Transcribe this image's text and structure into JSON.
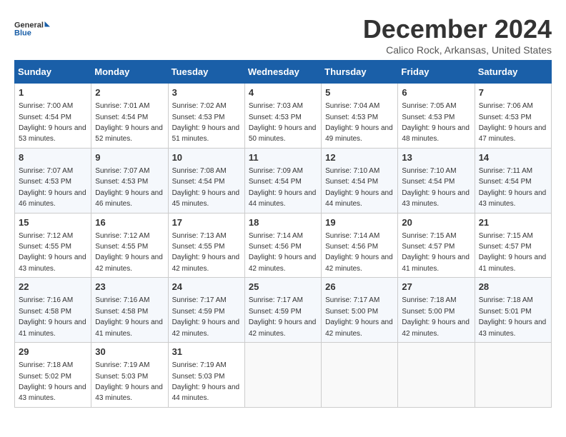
{
  "logo": {
    "line1": "General",
    "line2": "Blue"
  },
  "title": "December 2024",
  "location": "Calico Rock, Arkansas, United States",
  "days_of_week": [
    "Sunday",
    "Monday",
    "Tuesday",
    "Wednesday",
    "Thursday",
    "Friday",
    "Saturday"
  ],
  "weeks": [
    [
      {
        "day": "1",
        "sunrise": "7:00 AM",
        "sunset": "4:54 PM",
        "daylight": "9 hours and 53 minutes."
      },
      {
        "day": "2",
        "sunrise": "7:01 AM",
        "sunset": "4:54 PM",
        "daylight": "9 hours and 52 minutes."
      },
      {
        "day": "3",
        "sunrise": "7:02 AM",
        "sunset": "4:53 PM",
        "daylight": "9 hours and 51 minutes."
      },
      {
        "day": "4",
        "sunrise": "7:03 AM",
        "sunset": "4:53 PM",
        "daylight": "9 hours and 50 minutes."
      },
      {
        "day": "5",
        "sunrise": "7:04 AM",
        "sunset": "4:53 PM",
        "daylight": "9 hours and 49 minutes."
      },
      {
        "day": "6",
        "sunrise": "7:05 AM",
        "sunset": "4:53 PM",
        "daylight": "9 hours and 48 minutes."
      },
      {
        "day": "7",
        "sunrise": "7:06 AM",
        "sunset": "4:53 PM",
        "daylight": "9 hours and 47 minutes."
      }
    ],
    [
      {
        "day": "8",
        "sunrise": "7:07 AM",
        "sunset": "4:53 PM",
        "daylight": "9 hours and 46 minutes."
      },
      {
        "day": "9",
        "sunrise": "7:07 AM",
        "sunset": "4:53 PM",
        "daylight": "9 hours and 46 minutes."
      },
      {
        "day": "10",
        "sunrise": "7:08 AM",
        "sunset": "4:54 PM",
        "daylight": "9 hours and 45 minutes."
      },
      {
        "day": "11",
        "sunrise": "7:09 AM",
        "sunset": "4:54 PM",
        "daylight": "9 hours and 44 minutes."
      },
      {
        "day": "12",
        "sunrise": "7:10 AM",
        "sunset": "4:54 PM",
        "daylight": "9 hours and 44 minutes."
      },
      {
        "day": "13",
        "sunrise": "7:10 AM",
        "sunset": "4:54 PM",
        "daylight": "9 hours and 43 minutes."
      },
      {
        "day": "14",
        "sunrise": "7:11 AM",
        "sunset": "4:54 PM",
        "daylight": "9 hours and 43 minutes."
      }
    ],
    [
      {
        "day": "15",
        "sunrise": "7:12 AM",
        "sunset": "4:55 PM",
        "daylight": "9 hours and 43 minutes."
      },
      {
        "day": "16",
        "sunrise": "7:12 AM",
        "sunset": "4:55 PM",
        "daylight": "9 hours and 42 minutes."
      },
      {
        "day": "17",
        "sunrise": "7:13 AM",
        "sunset": "4:55 PM",
        "daylight": "9 hours and 42 minutes."
      },
      {
        "day": "18",
        "sunrise": "7:14 AM",
        "sunset": "4:56 PM",
        "daylight": "9 hours and 42 minutes."
      },
      {
        "day": "19",
        "sunrise": "7:14 AM",
        "sunset": "4:56 PM",
        "daylight": "9 hours and 42 minutes."
      },
      {
        "day": "20",
        "sunrise": "7:15 AM",
        "sunset": "4:57 PM",
        "daylight": "9 hours and 41 minutes."
      },
      {
        "day": "21",
        "sunrise": "7:15 AM",
        "sunset": "4:57 PM",
        "daylight": "9 hours and 41 minutes."
      }
    ],
    [
      {
        "day": "22",
        "sunrise": "7:16 AM",
        "sunset": "4:58 PM",
        "daylight": "9 hours and 41 minutes."
      },
      {
        "day": "23",
        "sunrise": "7:16 AM",
        "sunset": "4:58 PM",
        "daylight": "9 hours and 41 minutes."
      },
      {
        "day": "24",
        "sunrise": "7:17 AM",
        "sunset": "4:59 PM",
        "daylight": "9 hours and 42 minutes."
      },
      {
        "day": "25",
        "sunrise": "7:17 AM",
        "sunset": "4:59 PM",
        "daylight": "9 hours and 42 minutes."
      },
      {
        "day": "26",
        "sunrise": "7:17 AM",
        "sunset": "5:00 PM",
        "daylight": "9 hours and 42 minutes."
      },
      {
        "day": "27",
        "sunrise": "7:18 AM",
        "sunset": "5:00 PM",
        "daylight": "9 hours and 42 minutes."
      },
      {
        "day": "28",
        "sunrise": "7:18 AM",
        "sunset": "5:01 PM",
        "daylight": "9 hours and 43 minutes."
      }
    ],
    [
      {
        "day": "29",
        "sunrise": "7:18 AM",
        "sunset": "5:02 PM",
        "daylight": "9 hours and 43 minutes."
      },
      {
        "day": "30",
        "sunrise": "7:19 AM",
        "sunset": "5:03 PM",
        "daylight": "9 hours and 43 minutes."
      },
      {
        "day": "31",
        "sunrise": "7:19 AM",
        "sunset": "5:03 PM",
        "daylight": "9 hours and 44 minutes."
      },
      null,
      null,
      null,
      null
    ]
  ]
}
